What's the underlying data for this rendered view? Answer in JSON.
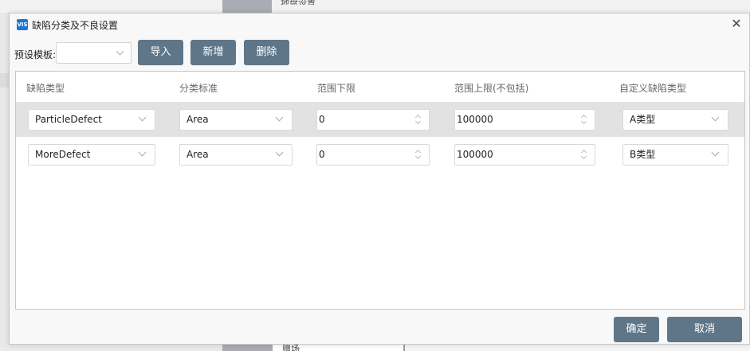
{
  "background": {
    "partial_text_top": "地盘设置",
    "bottom_tab_text": "赠场"
  },
  "dialog": {
    "app_icon_text": "VIS",
    "title": "缺陷分类及不良设置",
    "close_glyph": "✕"
  },
  "toolbar": {
    "preset_label": "预设模板:",
    "preset_value": "",
    "import_label": "导入",
    "add_label": "新增",
    "delete_label": "删除"
  },
  "grid": {
    "columns": [
      "缺陷类型",
      "分类标准",
      "范围下限",
      "范围上限(不包括)",
      "自定义缺陷类型"
    ],
    "rows": [
      {
        "defect_type": "ParticleDefect",
        "standard": "Area",
        "lower": "0",
        "upper": "100000",
        "custom_type": "A类型",
        "selected": true
      },
      {
        "defect_type": "MoreDefect",
        "standard": "Area",
        "lower": "0",
        "upper": "100000",
        "custom_type": "B类型",
        "selected": false
      }
    ]
  },
  "footer": {
    "ok_label": "确定",
    "cancel_label": "取消"
  },
  "colors": {
    "button": "#5f7688",
    "selected_row": "#e2e2e2",
    "icon": "#1976d2"
  }
}
